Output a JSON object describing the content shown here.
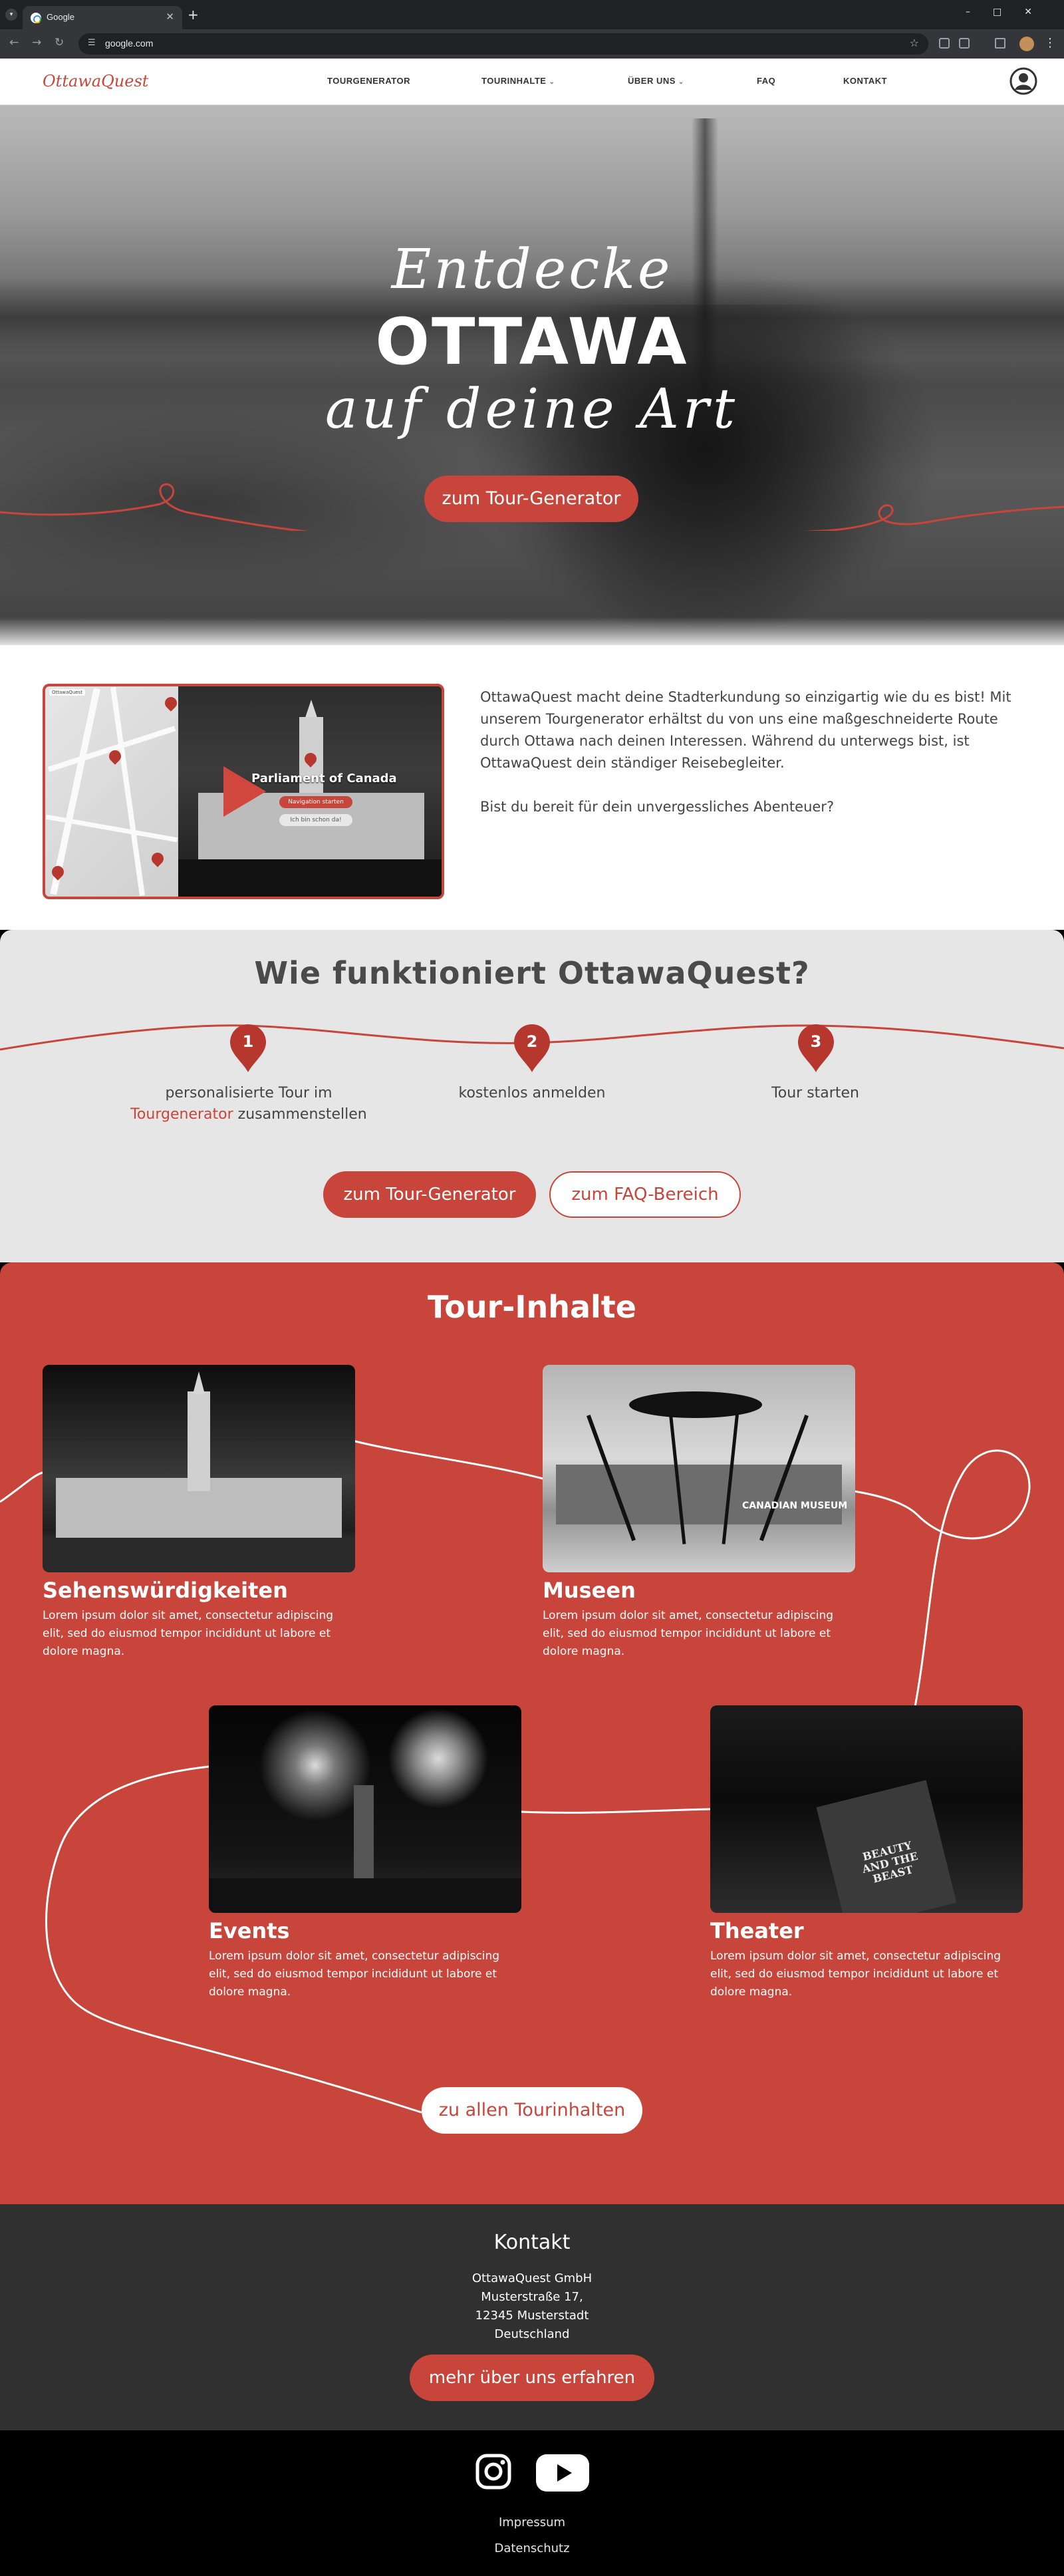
{
  "browser": {
    "tab_title": "Google",
    "url": "google.com"
  },
  "site": {
    "logo": "OttawaQuest",
    "nav": [
      {
        "label": "TOURGENERATOR"
      },
      {
        "label": "TOURINHALTE"
      },
      {
        "label": "ÜBER UNS"
      },
      {
        "label": "FAQ"
      },
      {
        "label": "KONTAKT"
      }
    ]
  },
  "hero": {
    "line1": "Entdecke",
    "line2": "OTTAWA",
    "line3": "auf deine Art",
    "button": "zum Tour-Generator"
  },
  "intro": {
    "paragraph1": "OttawaQuest macht deine Stadterkundung so einzigartig wie du es bist! Mit unserem Tourgenerator erhältst du von uns eine maßgeschneiderte Route durch Ottawa nach deinen Interessen. Während du unterwegs bist, ist OttawaQuest dein ständiger Reisebegleiter.",
    "paragraph2": "Bist du bereit für dein unvergessliches Abenteuer?",
    "video_title": "Parliament of Canada",
    "video_btn1": "Navigation starten",
    "video_btn2": "Ich bin schon da!"
  },
  "how": {
    "title": "Wie funktioniert OttawaQuest?",
    "steps": [
      {
        "num": "1",
        "text_a": "personalisierte Tour im",
        "link": "Tourgenerator",
        "text_b": "zusammenstellen"
      },
      {
        "num": "2",
        "text": "kostenlos anmelden"
      },
      {
        "num": "3",
        "text": "Tour starten"
      }
    ],
    "btn_generator": "zum Tour-Generator",
    "btn_faq": "zum FAQ-Bereich"
  },
  "tours": {
    "title": "Tour-Inhalte",
    "cards": [
      {
        "title": "Sehenswürdigkeiten",
        "desc": "Lorem ipsum dolor sit amet, consectetur adipiscing elit, sed do eiusmod tempor incididunt ut labore et dolore magna."
      },
      {
        "title": "Museen",
        "desc": "Lorem ipsum dolor sit amet, consectetur adipiscing elit, sed do eiusmod tempor incididunt ut labore et dolore magna."
      },
      {
        "title": "Events",
        "desc": "Lorem ipsum dolor sit amet, consectetur adipiscing elit, sed do eiusmod tempor incididunt ut labore et dolore magna."
      },
      {
        "title": "Theater",
        "desc": "Lorem ipsum dolor sit amet, consectetur adipiscing elit, sed do eiusmod tempor incididunt ut labore et dolore magna."
      }
    ],
    "museum_sign": "CANADIAN MUSEUM OF HISTORY",
    "theater_sign": "BEAUTY AND THE BEAST",
    "button": "zu allen Tourinhalten"
  },
  "contact": {
    "title": "Kontakt",
    "company": "OttawaQuest GmbH",
    "street": "Musterstraße 17,",
    "city": "12345 Musterstadt",
    "country": "Deutschland",
    "button": "mehr über uns erfahren"
  },
  "footer": {
    "imprint": "Impressum",
    "privacy": "Datenschutz"
  },
  "colors": {
    "accent": "#c8453b",
    "dark": "#303030",
    "light_bg": "#e6e6e6"
  }
}
